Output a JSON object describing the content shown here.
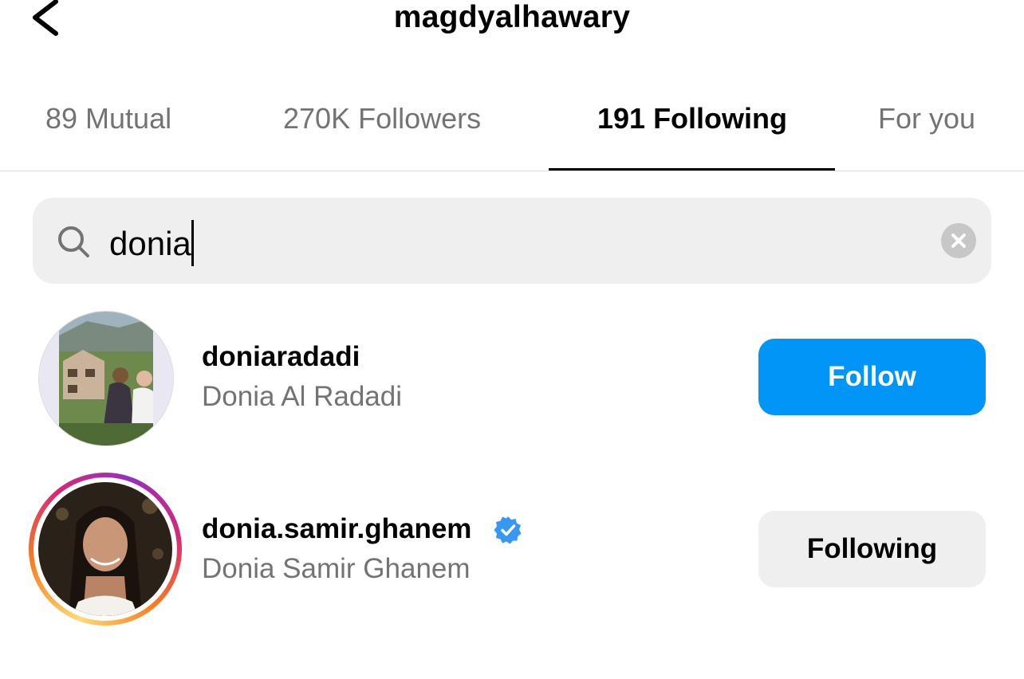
{
  "header": {
    "title": "magdyalhawary",
    "back_icon": "chevron-left-icon"
  },
  "tabs": [
    {
      "label": "89 Mutual",
      "active": false
    },
    {
      "label": "270K Followers",
      "active": false
    },
    {
      "label": "191 Following",
      "active": true
    },
    {
      "label": "For you",
      "active": false
    }
  ],
  "search": {
    "value": "donia",
    "icon": "search-icon",
    "clear_icon": "clear-icon"
  },
  "results": [
    {
      "username": "doniaradadi",
      "full_name": "Donia Al Radadi",
      "verified": false,
      "has_story_ring": false,
      "button_label": "Follow",
      "button_style": "primary"
    },
    {
      "username": "donia.samir.ghanem",
      "full_name": "Donia Samir Ghanem",
      "verified": true,
      "has_story_ring": true,
      "button_label": "Following",
      "button_style": "secondary"
    }
  ],
  "colors": {
    "accent": "#0095f6",
    "muted_text": "#737373",
    "input_bg": "#efefef",
    "verified_badge": "#3897f0"
  }
}
